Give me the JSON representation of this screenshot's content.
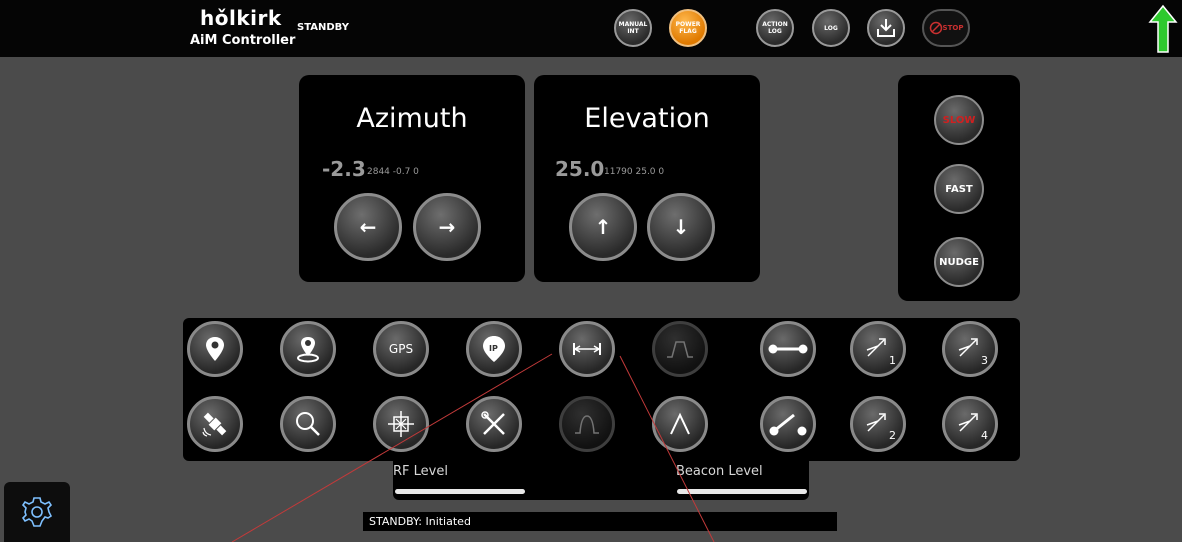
{
  "header": {
    "brand": "hǒlkirk",
    "subtitle": "AiM Controller",
    "state": "STANDBY",
    "buttons": [
      {
        "label_line1": "MANUAL",
        "label_line2": "INT"
      },
      {
        "label_line1": "POWER",
        "label_line2": "FLAG"
      },
      {
        "label_line1": "ACTION",
        "label_line2": "LOG"
      },
      {
        "label_line1": "LOG",
        "label_line2": ""
      },
      {
        "label_line1": "",
        "label_line2": ""
      },
      {
        "label_line1": "STOP",
        "label_line2": ""
      }
    ]
  },
  "azimuth": {
    "title": "Azimuth",
    "value": "-2.3",
    "detail": "2844 -0.7 0"
  },
  "elevation": {
    "title": "Elevation",
    "value": "25.0",
    "detail": "11790 25.0 0"
  },
  "speed": {
    "slow": "SLOW",
    "fast": "FAST",
    "nudge": "NUDGE"
  },
  "tools": {
    "gps_label": "GPS",
    "ip_label": "IP",
    "sweep1": "1",
    "sweep2": "2",
    "sweep3": "3",
    "sweep4": "4"
  },
  "levels": {
    "rf_label": "RF Level",
    "beacon_label": "Beacon Level",
    "rf_fill": 1.0,
    "beacon_fill": 1.0
  },
  "status": {
    "text": "STANDBY: Initiated"
  },
  "colors": {
    "accent_orange": "#f39a1e",
    "slow_red": "#d02020",
    "up_arrow_green": "#2ec92e",
    "annotation_line": "#c23a3a"
  }
}
